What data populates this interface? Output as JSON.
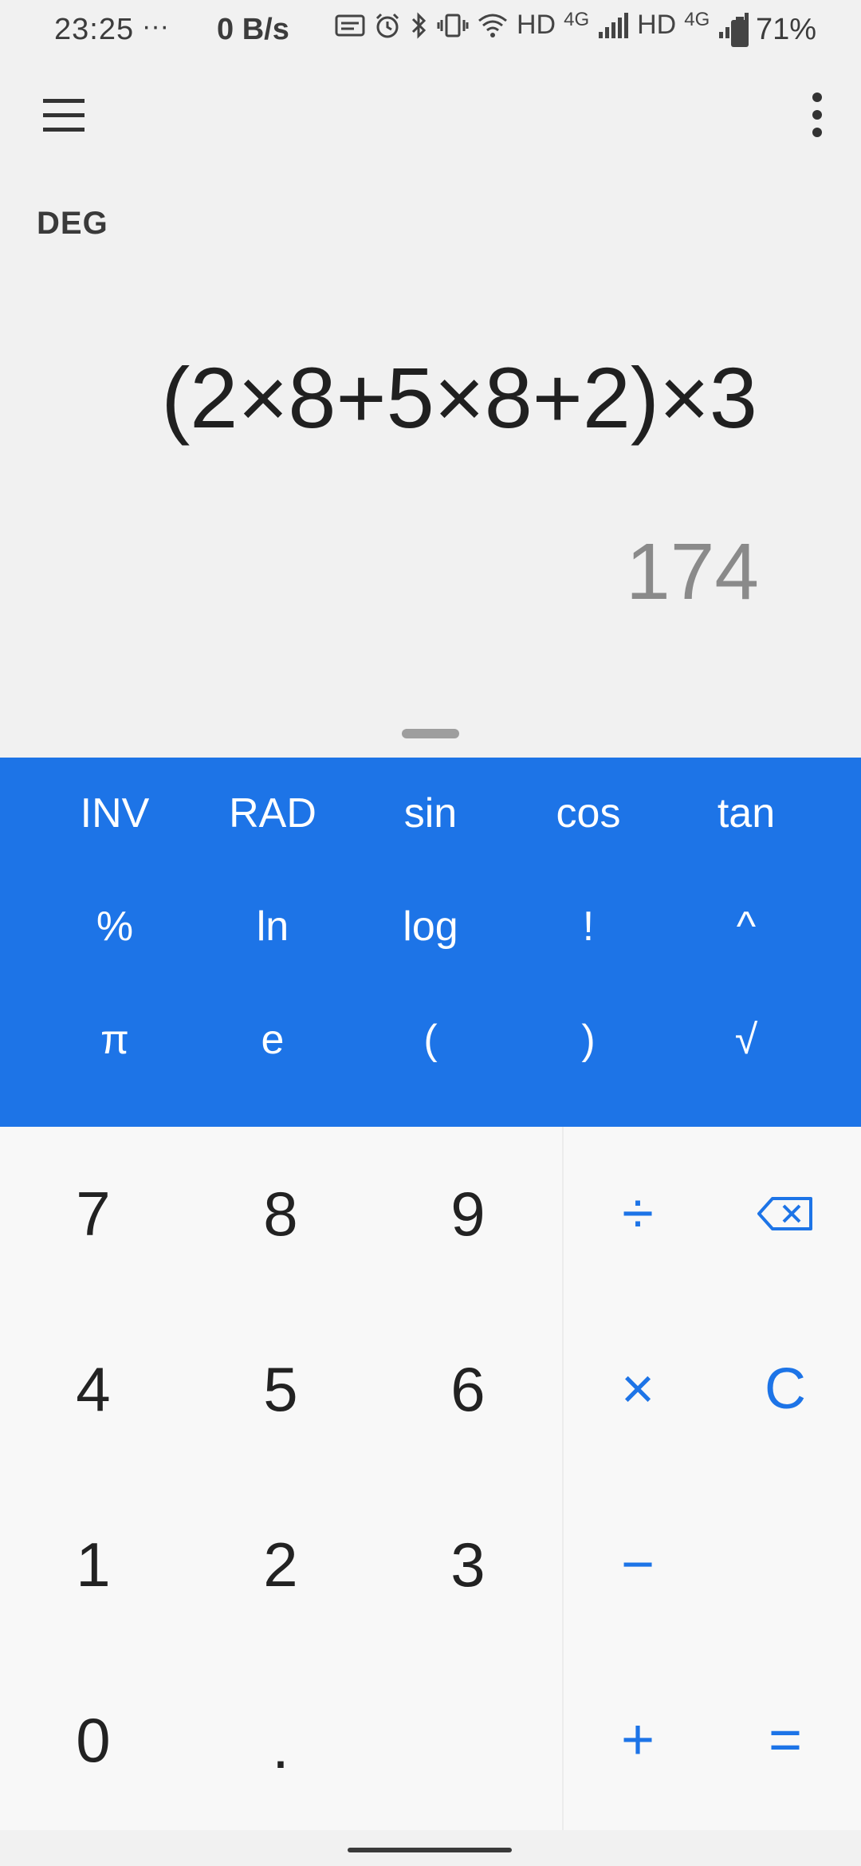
{
  "status_bar": {
    "time": "23:25",
    "dots": "···",
    "net_speed": "0 B/s",
    "hd1": "HD",
    "net1": "4G",
    "hd2": "HD",
    "net2": "4G",
    "battery": "71%"
  },
  "display": {
    "mode": "DEG",
    "expression": "(2×8+5×8+2)×3",
    "result": "174"
  },
  "advanced_keys": [
    [
      "INV",
      "RAD",
      "sin",
      "cos",
      "tan"
    ],
    [
      "%",
      "ln",
      "log",
      "!",
      "^"
    ],
    [
      "π",
      "e",
      "(",
      ")",
      "√"
    ]
  ],
  "number_keys": {
    "k7": "7",
    "k8": "8",
    "k9": "9",
    "k4": "4",
    "k5": "5",
    "k6": "6",
    "k1": "1",
    "k2": "2",
    "k3": "3",
    "k0": "0",
    "dot": "."
  },
  "operator_keys": {
    "divide": "÷",
    "multiply": "×",
    "clear": "C",
    "minus": "−",
    "plus": "+",
    "equals": "="
  },
  "colors": {
    "accent": "#1d74e7",
    "display_bg": "#f1f1f1",
    "pad_bg": "#f8f8f8"
  },
  "icons": [
    "menu-icon",
    "more-vert-icon",
    "backspace-icon"
  ]
}
